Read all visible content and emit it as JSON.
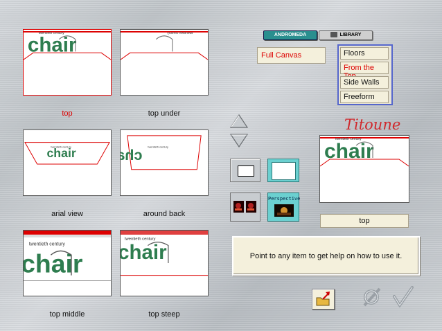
{
  "tabs": [
    {
      "label": "ANDROMEDA",
      "active": true
    },
    {
      "label": "LIBRARY",
      "active": false
    }
  ],
  "presets": [
    {
      "label": "top",
      "selected": true
    },
    {
      "label": "top under",
      "selected": false
    },
    {
      "label": "arial view",
      "selected": false
    },
    {
      "label": "around back",
      "selected": false
    },
    {
      "label": "top middle",
      "selected": false
    },
    {
      "label": "top steep",
      "selected": false
    }
  ],
  "canvas_select": {
    "value": "Full Canvas"
  },
  "mode_list": [
    {
      "label": "Floors",
      "selected": false
    },
    {
      "label": "From the Top",
      "selected": true
    },
    {
      "label": "Side Walls",
      "selected": false
    },
    {
      "label": "Freeform",
      "selected": false
    }
  ],
  "signature": "Titoune",
  "preview": {
    "label": "top"
  },
  "perspective_button": {
    "label": "Perspective"
  },
  "thumbnail_text": {
    "word": "chair",
    "tagline": "twentieth century"
  },
  "help": {
    "text": "Point to any item to get help on how to use it."
  },
  "icons": {
    "arrow_up": "arrow-up-icon",
    "arrow_down": "arrow-down-icon",
    "cancel": "cancel-icon",
    "ok": "checkmark-icon",
    "export": "folder-export-icon"
  },
  "colors": {
    "accent_red": "#d00000",
    "teal": "#2a8f8f",
    "chair_green": "#2e7d4f",
    "list_border": "#5566cc"
  }
}
